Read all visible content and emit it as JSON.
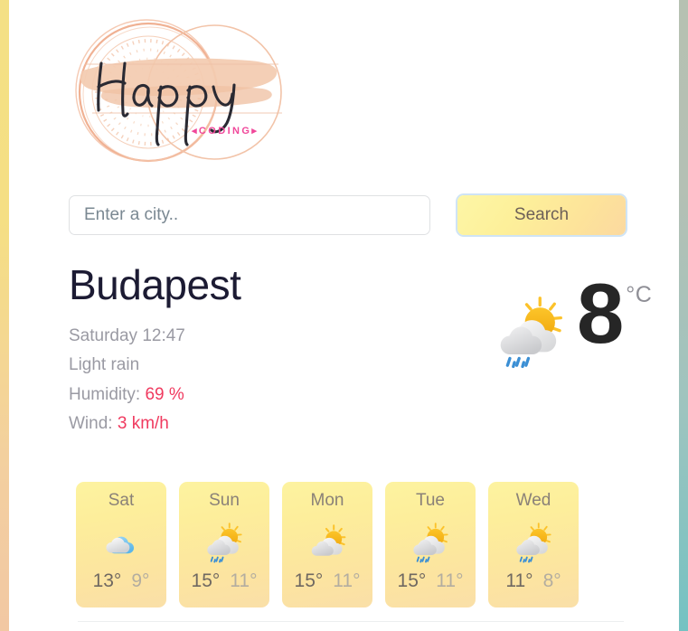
{
  "logo": {
    "wordmark": "Happy",
    "tagline": "◂CODING▸",
    "ring_color": "#f0b193",
    "brush_color": "#f3cbb0",
    "tagline_color": "#f0479a",
    "script_color": "#2a2a33"
  },
  "search": {
    "placeholder": "Enter a city..",
    "value": "",
    "button_label": "Search",
    "button_gradient_from": "#fdf6a6",
    "button_gradient_to": "#fbd9a0"
  },
  "current": {
    "city": "Budapest",
    "datetime": "Saturday 12:47",
    "condition": "Light rain",
    "humidity_label": "Humidity:",
    "humidity_value": "69 %",
    "wind_label": "Wind:",
    "wind_value": "3 km/h",
    "temperature": "8",
    "unit": "°C",
    "icon": "rain-sun-cloud-icon",
    "accent_color": "#f03a5f",
    "city_color": "#1c1b33"
  },
  "forecast": [
    {
      "day": "Sat",
      "icon": "broken-clouds-icon",
      "max": "13°",
      "min": "9°"
    },
    {
      "day": "Sun",
      "icon": "rain-sun-cloud-icon",
      "max": "15°",
      "min": "11°"
    },
    {
      "day": "Mon",
      "icon": "sun-cloud-icon",
      "max": "15°",
      "min": "11°"
    },
    {
      "day": "Tue",
      "icon": "rain-sun-cloud-icon",
      "max": "15°",
      "min": "11°"
    },
    {
      "day": "Wed",
      "icon": "rain-sun-cloud-icon",
      "max": "11°",
      "min": "8°"
    }
  ],
  "theme": {
    "left_strip_from": "#f4e085",
    "left_strip_to": "#f2c8a3",
    "right_strip_from": "#b6c1b2",
    "right_strip_to": "#74c2c2",
    "card_gradient_from": "#fdf3a0",
    "card_gradient_to": "#fadfa8"
  }
}
